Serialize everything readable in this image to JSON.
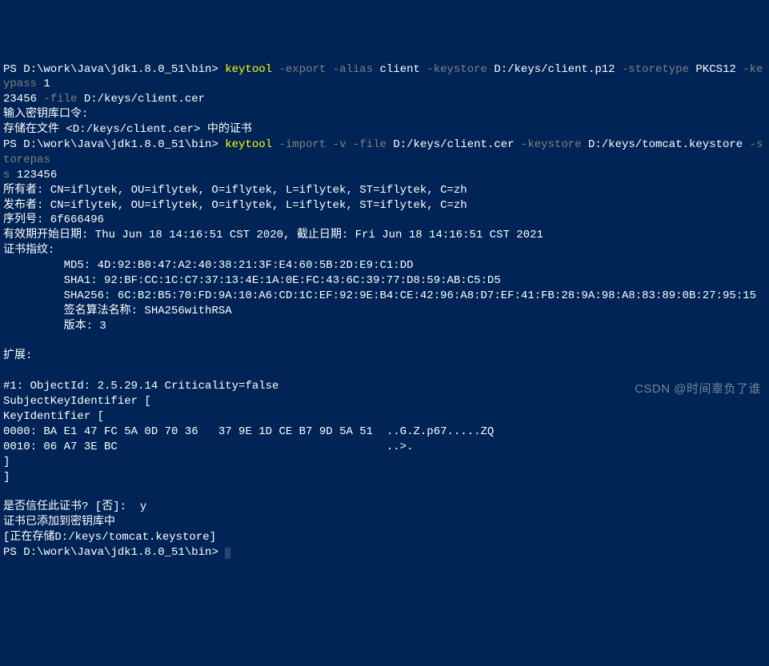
{
  "cmd1": {
    "prompt": "PS D:\\work\\Java\\jdk1.8.0_51\\bin> ",
    "exe": "keytool",
    "f_export": " -export",
    "f_alias": " -alias",
    "v_alias": " client",
    "f_keystore": " -keystore",
    "v_keystore": " D:/keys/client.p12",
    "f_storetype": " -storetype",
    "v_storetype": " PKCS12",
    "f_keypass": " -keypass",
    "v_keypass_a": " 1",
    "v_keypass_b": "23456",
    "f_file": " -file",
    "v_file": " D:/keys/client.cer"
  },
  "out1": {
    "l1": "输入密钥库口令:",
    "l2": "存储在文件 <D:/keys/client.cer> 中的证书"
  },
  "cmd2": {
    "prompt": "PS D:\\work\\Java\\jdk1.8.0_51\\bin> ",
    "exe": "keytool",
    "f_import": " -import",
    "f_v": " -v",
    "f_file": " -file",
    "v_file": " D:/keys/client.cer",
    "f_keystore": " -keystore",
    "v_keystore": " D:/keys/tomcat.keystore",
    "f_storepass": " -storepas",
    "v_storepass_a": "s",
    "v_storepass_b": " 123456"
  },
  "cert": {
    "owner": "所有者: CN=iflytek, OU=iflytek, O=iflytek, L=iflytek, ST=iflytek, C=zh",
    "issuer": "发布者: CN=iflytek, OU=iflytek, O=iflytek, L=iflytek, ST=iflytek, C=zh",
    "serial": "序列号: 6f666496",
    "validity": "有效期开始日期: Thu Jun 18 14:16:51 CST 2020, 截止日期: Fri Jun 18 14:16:51 CST 2021",
    "fp_hdr": "证书指纹:",
    "md5": "         MD5: 4D:92:B0:47:A2:40:38:21:3F:E4:60:5B:2D:E9:C1:DD",
    "sha1": "         SHA1: 92:BF:CC:1C:C7:37:13:4E:1A:0E:FC:43:6C:39:77:D8:59:AB:C5:D5",
    "sha256": "         SHA256: 6C:B2:B5:70:FD:9A:10:A6:CD:1C:EF:92:9E:B4:CE:42:96:A8:D7:EF:41:FB:28:9A:98:A8:83:89:0B:27:95:15",
    "sigalg": "         签名算法名称: SHA256withRSA",
    "ver": "         版本: 3"
  },
  "ext": {
    "hdr": "扩展:",
    "blank": "",
    "obj": "#1: ObjectId: 2.5.29.14 Criticality=false",
    "ski": "SubjectKeyIdentifier [",
    "kid": "KeyIdentifier [",
    "hex0": "0000: BA E1 47 FC 5A 0D 70 36   37 9E 1D CE B7 9D 5A 51  ..G.Z.p67.....ZQ",
    "hex1": "0010: 06 A7 3E BC                                        ..>.",
    "close1": "]",
    "close2": "]"
  },
  "trust": {
    "q": "是否信任此证书? [否]:  ",
    "ans": "y",
    "added": "证书已添加到密钥库中",
    "storing": "[正在存储D:/keys/tomcat.keystore]"
  },
  "prompt3": "PS D:\\work\\Java\\jdk1.8.0_51\\bin> ",
  "watermark": "CSDN @时间辜负了谁"
}
